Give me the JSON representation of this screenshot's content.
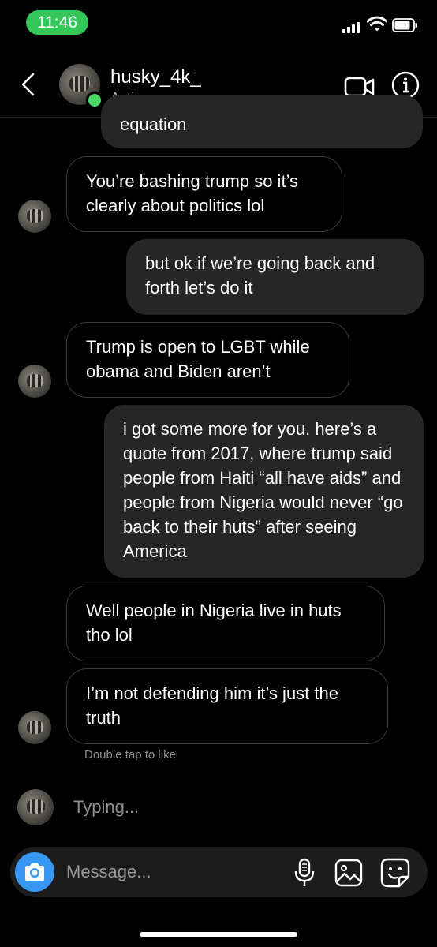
{
  "status_bar": {
    "time": "11:46"
  },
  "header": {
    "username": "husky_4k_",
    "activity": "Active now"
  },
  "messages": [
    {
      "from": "them",
      "text": "equation"
    },
    {
      "from": "them",
      "text": "You’re bashing trump so it’s clearly about politics lol"
    },
    {
      "from": "me",
      "text": "but ok if we’re going back and forth let’s do it"
    },
    {
      "from": "them",
      "text": "Trump is open to LGBT while obama and Biden aren’t"
    },
    {
      "from": "me",
      "text": "i got some more for you. here’s a quote from 2017, where trump said people from Haiti “all have aids” and people from Nigeria would never “go back to their huts” after seeing America"
    },
    {
      "from": "them",
      "text": "Well people in Nigeria live in huts tho lol"
    },
    {
      "from": "them",
      "text": "I’m not defending him it’s just the truth"
    }
  ],
  "hint": "Double tap to like",
  "typing_indicator": "Typing...",
  "composer": {
    "placeholder": "Message..."
  },
  "colors": {
    "accent": "#3897f0",
    "online": "#4cd964",
    "time_pill": "#34c759",
    "outgoing_bubble": "#262626"
  },
  "icons": [
    "back-chevron-icon",
    "video-call-icon",
    "info-icon",
    "camera-icon",
    "microphone-icon",
    "gallery-icon",
    "sticker-icon"
  ]
}
